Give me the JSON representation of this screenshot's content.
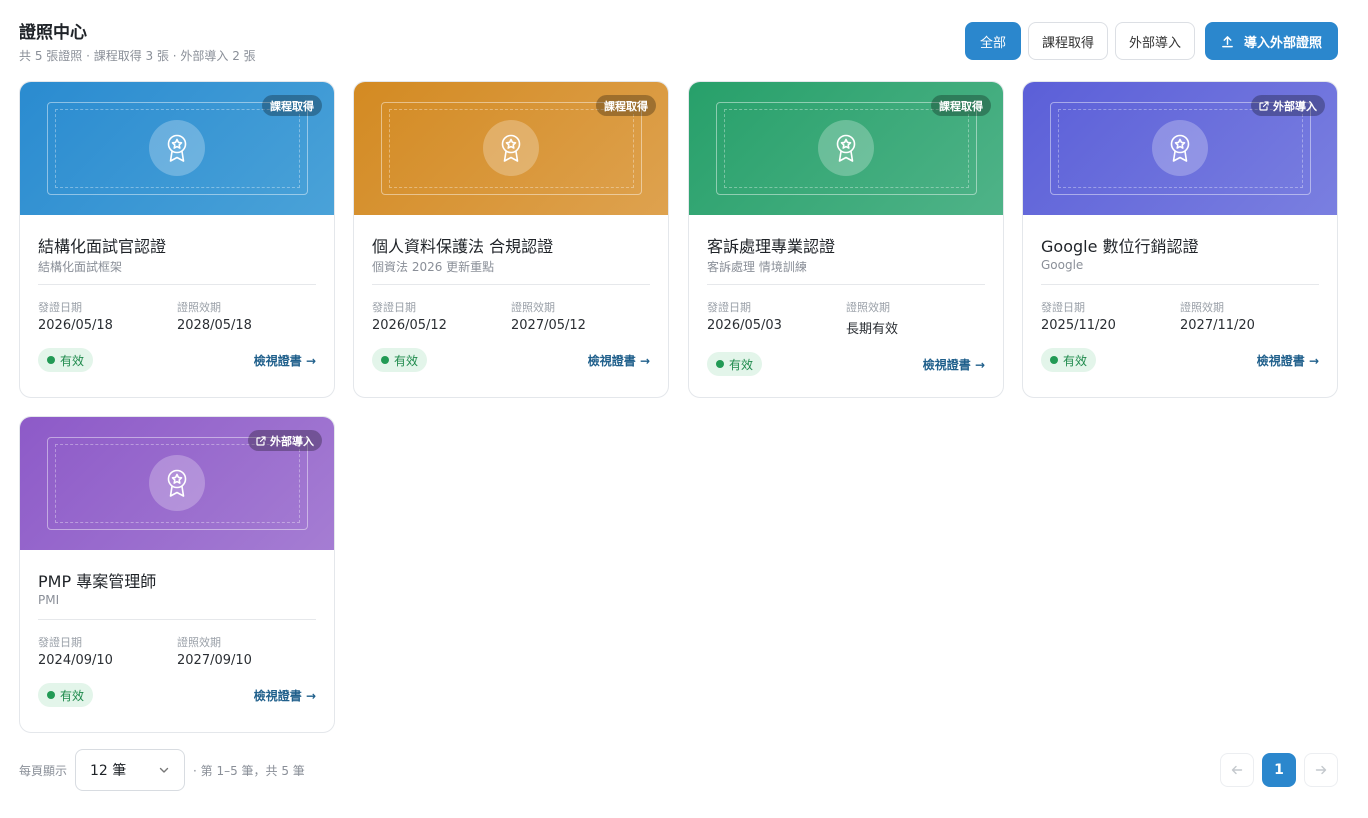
{
  "header": {
    "title": "證照中心",
    "subtitle": "共 5 張證照 · 課程取得 3 張 · 外部導入 2 張"
  },
  "filters": {
    "all": "全部",
    "course": "課程取得",
    "external": "外部導入",
    "import_button": "導入外部證照"
  },
  "labels": {
    "issue_date": "發證日期",
    "expiry": "證照效期",
    "view": "檢視證書 →"
  },
  "certificates": [
    {
      "title": "結構化面試官認證",
      "subtitle": "結構化面試框架",
      "source": "課程取得",
      "source_type": "course",
      "issue_date": "2026/05/18",
      "expiry": "2028/05/18",
      "status": "有效",
      "color_from": "#2a8bd0",
      "color_to": "#4aa2d8"
    },
    {
      "title": "個人資料保護法 合規認證",
      "subtitle": "個資法 2026 更新重點",
      "source": "課程取得",
      "source_type": "course",
      "issue_date": "2026/05/12",
      "expiry": "2027/05/12",
      "status": "有效",
      "color_from": "#d38a22",
      "color_to": "#dea24f"
    },
    {
      "title": "客訴處理專業認證",
      "subtitle": "客訴處理 情境訓練",
      "source": "課程取得",
      "source_type": "course",
      "issue_date": "2026/05/03",
      "expiry": "長期有效",
      "status": "有效",
      "color_from": "#27a06a",
      "color_to": "#4fb388"
    },
    {
      "title": "Google 數位行銷認證",
      "subtitle": "Google",
      "source": "外部導入",
      "source_type": "external",
      "issue_date": "2025/11/20",
      "expiry": "2027/11/20",
      "status": "有效",
      "color_from": "#5b5fd8",
      "color_to": "#7a7fe0"
    },
    {
      "title": "PMP 專案管理師",
      "subtitle": "PMI",
      "source": "外部導入",
      "source_type": "external",
      "issue_date": "2024/09/10",
      "expiry": "2027/09/10",
      "status": "有效",
      "color_from": "#8d5ac8",
      "color_to": "#a57dd3"
    }
  ],
  "pagination": {
    "per_page_label": "每頁顯示",
    "per_page_value": "12 筆",
    "range_text": "· 第 1–5 筆，共 5 筆",
    "current_page": "1",
    "prev_icon": "arrow-left-icon",
    "next_icon": "arrow-right-icon"
  },
  "colors": {
    "accent": "#2b87cd",
    "status_bg": "#e3f5ea",
    "status_text": "#1e8a4c"
  }
}
